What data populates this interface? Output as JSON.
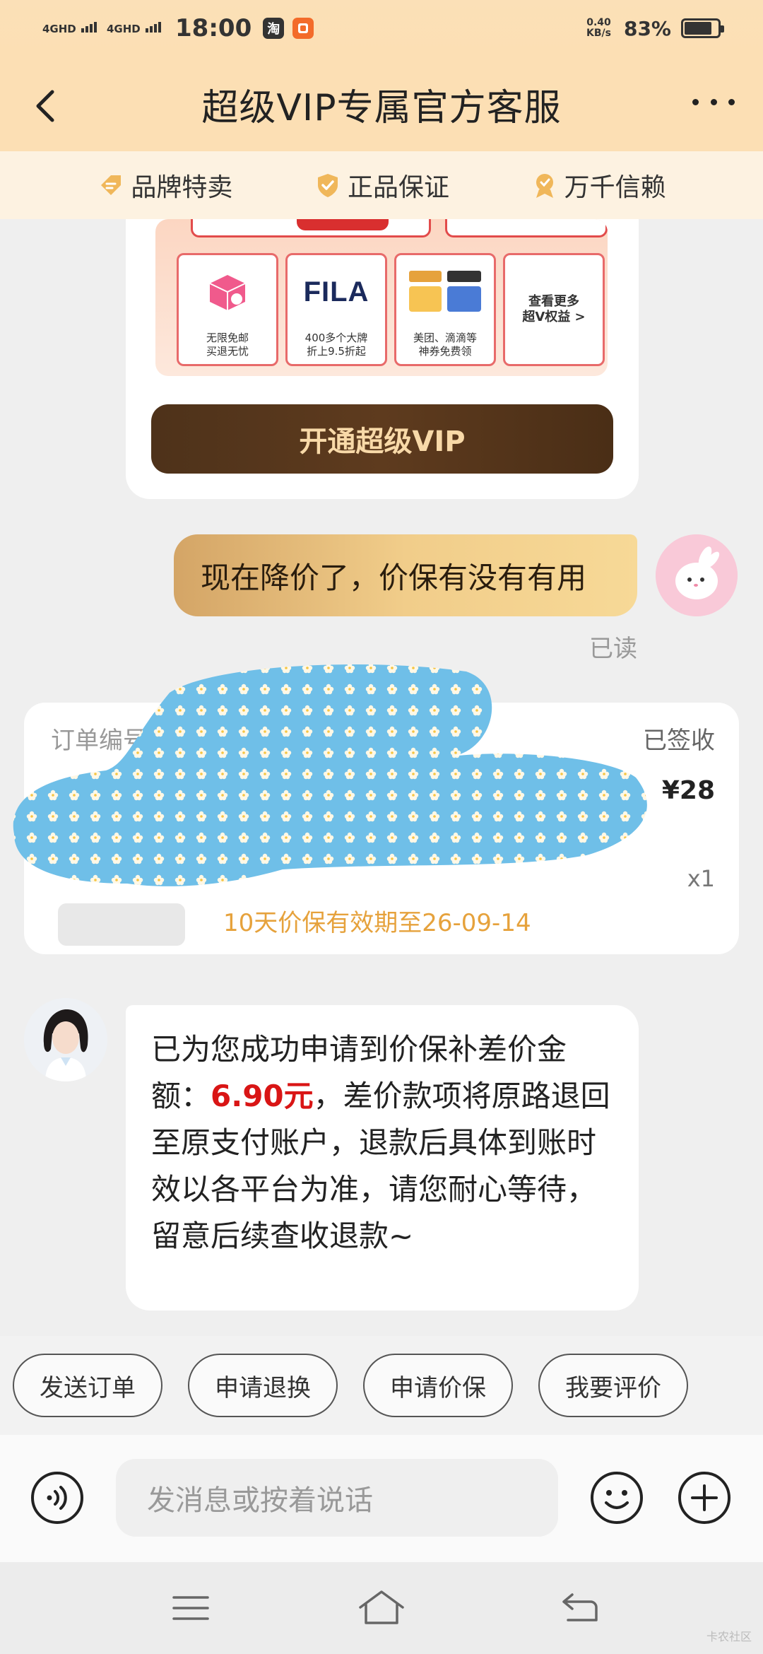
{
  "status_bar": {
    "sim1": "4GHD",
    "sim2": "4GHD",
    "time": "18:00",
    "app1": "淘",
    "net_speed_value": "0.40",
    "net_speed_unit": "KB/s",
    "battery": "83%",
    "battery_level": 0.83
  },
  "header": {
    "title": "超级VIP专属官方客服"
  },
  "trust_bar": {
    "items": [
      "品牌特卖",
      "正品保证",
      "万千信赖"
    ]
  },
  "vip_card": {
    "benefits": [
      {
        "line1": "无限免邮",
        "line2": "买退无忧"
      },
      {
        "line1": "400多个大牌",
        "line2": "折上9.5折起"
      },
      {
        "line1": "美团、滴滴等",
        "line2": "神券免费领"
      }
    ],
    "benefit_logo": "FILA",
    "more_line1": "查看更多",
    "more_line2": "超V权益 >",
    "button_label": "开通超级VIP"
  },
  "outgoing_message": {
    "text": "现在降价了，价保有没有有用",
    "read_status": "已读"
  },
  "order_card": {
    "label": "订单编号",
    "status": "已签收",
    "price": "¥28",
    "quantity": "x1",
    "price_protect": "10天价保有效期至26-09-14"
  },
  "agent_message": {
    "part1": "已为您成功申请到价保补差价金额：",
    "amount": "6.90元",
    "part2": "，差价款项将原路退回至原支付账户，退款后具体到账时效以各平台为准，请您耐心等待，留意后续查收退款~",
    "amount_color": "#d91515"
  },
  "quick_actions": [
    "发送订单",
    "申请退换",
    "申请价保",
    "我要评价"
  ],
  "input_bar": {
    "placeholder": "发消息或按着说话"
  },
  "watermark": "卡农社区",
  "colors": {
    "header_bg": "#fcdfb4",
    "vip_button_bg": "#4e321a",
    "outgoing_bubble": "#f1cd8a",
    "price_protect_text": "#e6a23c"
  }
}
